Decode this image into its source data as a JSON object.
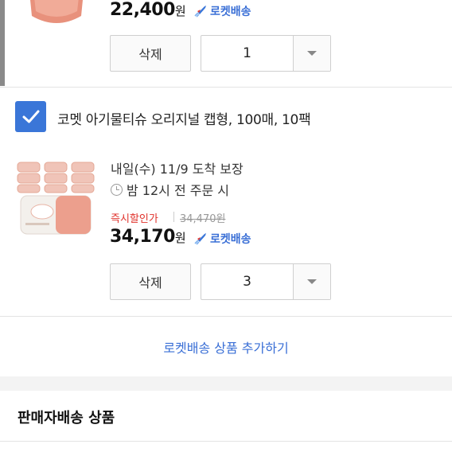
{
  "top_item": {
    "price": "22,400",
    "currency": "원",
    "rocket_label": "로켓배송",
    "delete_label": "삭제",
    "quantity": "1"
  },
  "item2": {
    "checked": true,
    "title": "코멧 아기물티슈 오리지널 캡형, 100매, 10팩",
    "delivery": "내일(수) 11/9 도착 보장",
    "cutoff": "밤 12시 전 주문 시",
    "discount_label": "즉시할인가",
    "original_price": "34,470원",
    "price": "34,170",
    "currency": "원",
    "rocket_label": "로켓배송",
    "delete_label": "삭제",
    "quantity": "3"
  },
  "add_rocket_link": "로켓배송 상품 추가하기",
  "seller_section_title": "판매자배송 상품",
  "colors": {
    "accent_blue": "#3a76d8",
    "discount_red": "#e0322b"
  }
}
